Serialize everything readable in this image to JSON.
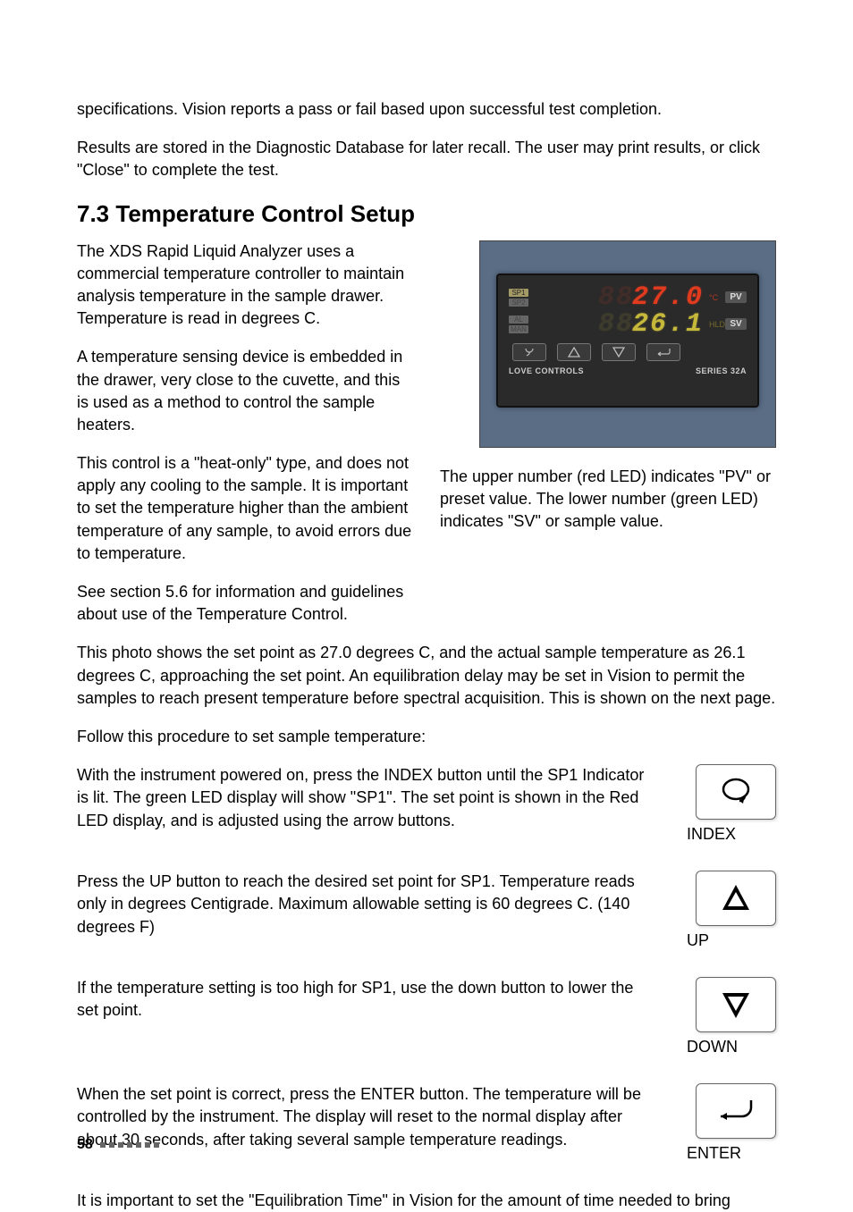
{
  "intro": {
    "p1": "specifications. Vision reports a pass or fail based upon successful test completion.",
    "p2": "Results are stored in the Diagnostic Database for later recall. The user may print results, or click \"Close\" to complete the test."
  },
  "section": {
    "title": "7.3   Temperature Control Setup",
    "p1": "The XDS Rapid Liquid Analyzer uses a commercial temperature controller to maintain analysis temperature in the sample drawer. Temperature is read in degrees C.",
    "p2": "A temperature sensing device is embedded in the drawer, very close to the cuvette, and this is used as a method to control the sample heaters.",
    "p3": "This control is a \"heat-only\" type, and does not apply any cooling to the sample. It is important to set the temperature higher than the ambient temperature of any sample, to avoid errors due to temperature.",
    "p4": "See section 5.6 for information and guidelines about use of the Temperature Control.",
    "caption": "The upper number (red LED) indicates \"PV\" or preset value. The lower number (green LED) indicates \"SV\" or sample value.",
    "p5": "This photo shows the set point as 27.0 degrees C, and the actual sample temperature as 26.1 degrees C, approaching the set point. An equilibration delay may be set in Vision to permit the samples to reach present temperature before spectral acquisition. This is shown on the next page.",
    "p6": "Follow this procedure to set sample temperature:"
  },
  "controller": {
    "pv_value": "27.0",
    "sv_value": "26.1",
    "unit": "°C",
    "pv_badge": "PV",
    "sv_badge": "SV",
    "tags": {
      "sp1": "SP1",
      "sp2": "SP2",
      "al": "AL",
      "man": "MAN",
      "hld": "HLD"
    },
    "footer_left": "LOVE CONTROLS",
    "footer_right": "SERIES 32A"
  },
  "steps": {
    "index": {
      "text": "With the instrument powered on, press the INDEX button until the SP1 Indicator is lit. The green LED display will show \"SP1\". The set point is shown in the Red LED display, and is adjusted using the arrow buttons.",
      "label": "INDEX"
    },
    "up": {
      "text": "Press the UP button to reach the desired set point for SP1. Temperature reads only in degrees Centigrade. Maximum allowable setting is 60 degrees C. (140 degrees F)",
      "label": "UP"
    },
    "down": {
      "text": "If the temperature setting is too high for SP1, use the down button to lower the set point.",
      "label": "DOWN"
    },
    "enter": {
      "text": "When the set point is correct, press the ENTER button. The temperature will be controlled by the instrument. The display will reset to the normal display after about 30 seconds, after taking several sample temperature readings.",
      "label": "ENTER"
    }
  },
  "closing": {
    "p1": "It is important to set the \"Equilibration Time\" in Vision for the amount of time needed to bring"
  },
  "page_number": "58"
}
